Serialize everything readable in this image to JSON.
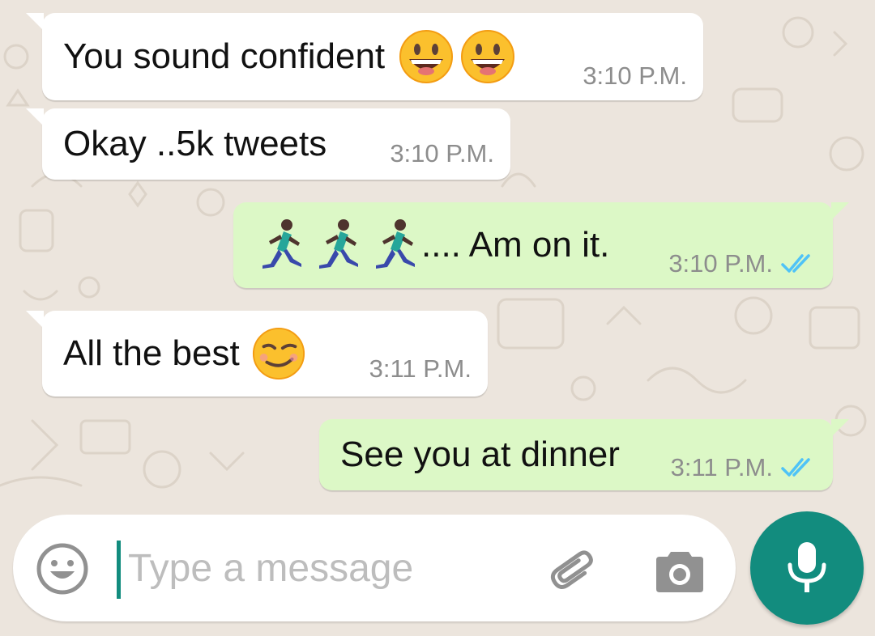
{
  "messages": [
    {
      "direction": "incoming",
      "text": "You sound confident",
      "emoji": [
        "grinning-face",
        "grinning-face"
      ],
      "time": "3:10 P.M."
    },
    {
      "direction": "incoming",
      "text": "Okay ..5k tweets",
      "emoji": [],
      "time": "3:10 P.M."
    },
    {
      "direction": "outgoing",
      "text": ".... Am on it.",
      "emoji": [
        "man-running",
        "man-running",
        "man-running"
      ],
      "time": "3:10 P.M.",
      "status": "read"
    },
    {
      "direction": "incoming",
      "text": "All the best",
      "emoji": [
        "smirking-face"
      ],
      "time": "3:11 P.M."
    },
    {
      "direction": "outgoing",
      "text": "See you at dinner",
      "emoji": [],
      "time": "3:11 P.M.",
      "status": "read"
    }
  ],
  "composer": {
    "placeholder": "Type a message",
    "value": "",
    "icons": {
      "emoji": "emoji-icon",
      "attach": "paperclip-icon",
      "camera": "camera-icon",
      "mic": "mic-icon"
    }
  },
  "colors": {
    "background": "#ece5dd",
    "incoming_bubble": "#ffffff",
    "outgoing_bubble": "#dcf8c6",
    "accent": "#128c7e",
    "read_ticks": "#4fc3f7",
    "timestamp": "#8d8d8d"
  }
}
